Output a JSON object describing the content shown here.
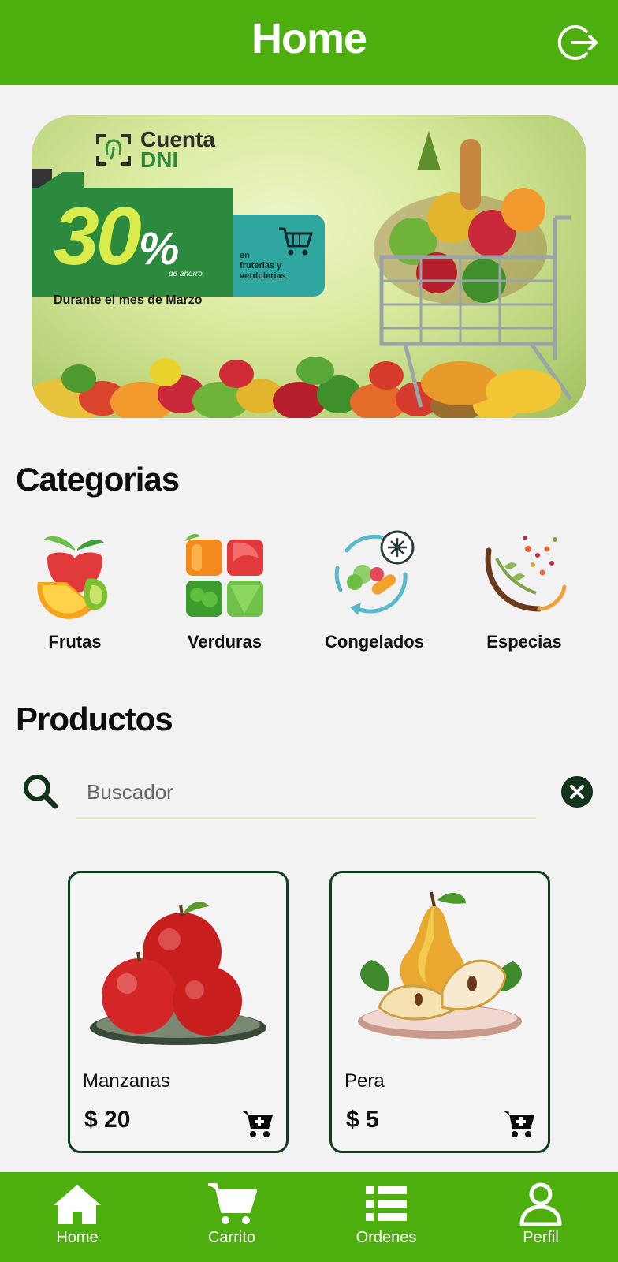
{
  "header": {
    "title": "Home",
    "logout_icon": "logout-icon"
  },
  "banner": {
    "brand_line1": "Cuenta",
    "brand_line2": "DNI",
    "discount": "30",
    "discount_unit": "%",
    "discount_caption": "de ahorro",
    "where_line1": "en",
    "where_line2": "fruterias y",
    "where_line3": "verdulerias",
    "period": "Durante el mes de Marzo"
  },
  "categories": {
    "title": "Categorias",
    "items": [
      {
        "label": "Frutas",
        "icon": "fruits-icon"
      },
      {
        "label": "Verduras",
        "icon": "vegetables-icon"
      },
      {
        "label": "Congelados",
        "icon": "frozen-icon"
      },
      {
        "label": "Especias",
        "icon": "spices-icon"
      }
    ]
  },
  "products": {
    "title": "Productos",
    "search": {
      "placeholder": "Buscador",
      "value": ""
    },
    "items": [
      {
        "name": "Manzanas",
        "price": "$ 20",
        "image": "apples-image"
      },
      {
        "name": "Pera",
        "price": "$ 5",
        "image": "pears-image"
      }
    ]
  },
  "bottom_nav": {
    "items": [
      {
        "label": "Home",
        "icon": "home-icon"
      },
      {
        "label": "Carrito",
        "icon": "cart-icon"
      },
      {
        "label": "Ordenes",
        "icon": "list-icon"
      },
      {
        "label": "Perfil",
        "icon": "user-icon"
      }
    ]
  },
  "colors": {
    "primary": "#4caf0e",
    "dark_green": "#0f3d1e",
    "background": "#f2f2f2"
  }
}
